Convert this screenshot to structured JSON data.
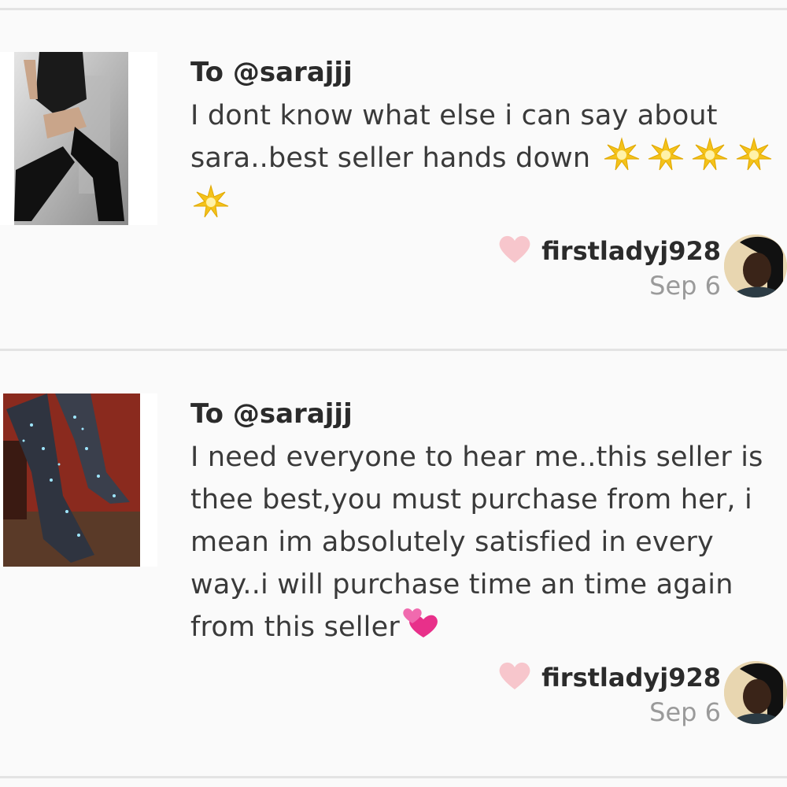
{
  "reviews": [
    {
      "to": "To @sarajjj",
      "text_lines": [
        "I dont know what else i can say about",
        "sara..best seller hands down"
      ],
      "star_count_line2": 4,
      "star_count_line3": 1,
      "username": "firstladyj928",
      "date": "Sep 6",
      "thumb": "black-thigh-high-boots-photo",
      "emoji": "glowing-star"
    },
    {
      "to": "To @sarajjj",
      "text_lines": [
        "I need everyone to hear me..this seller is",
        "thee best,you must purchase from her, i",
        "mean im absolutely satisfied in every",
        "way..i will purchase time an time again",
        "from this seller"
      ],
      "username": "firstladyj928",
      "date": "Sep 6",
      "thumb": "rhinestone-boots-photo",
      "emoji": "two-hearts"
    }
  ],
  "colors": {
    "background": "#fafafa",
    "divider": "#e3e3e3",
    "heart": "#f7c6cc",
    "date": "#9a9a9a",
    "text": "#3a3a3a"
  }
}
